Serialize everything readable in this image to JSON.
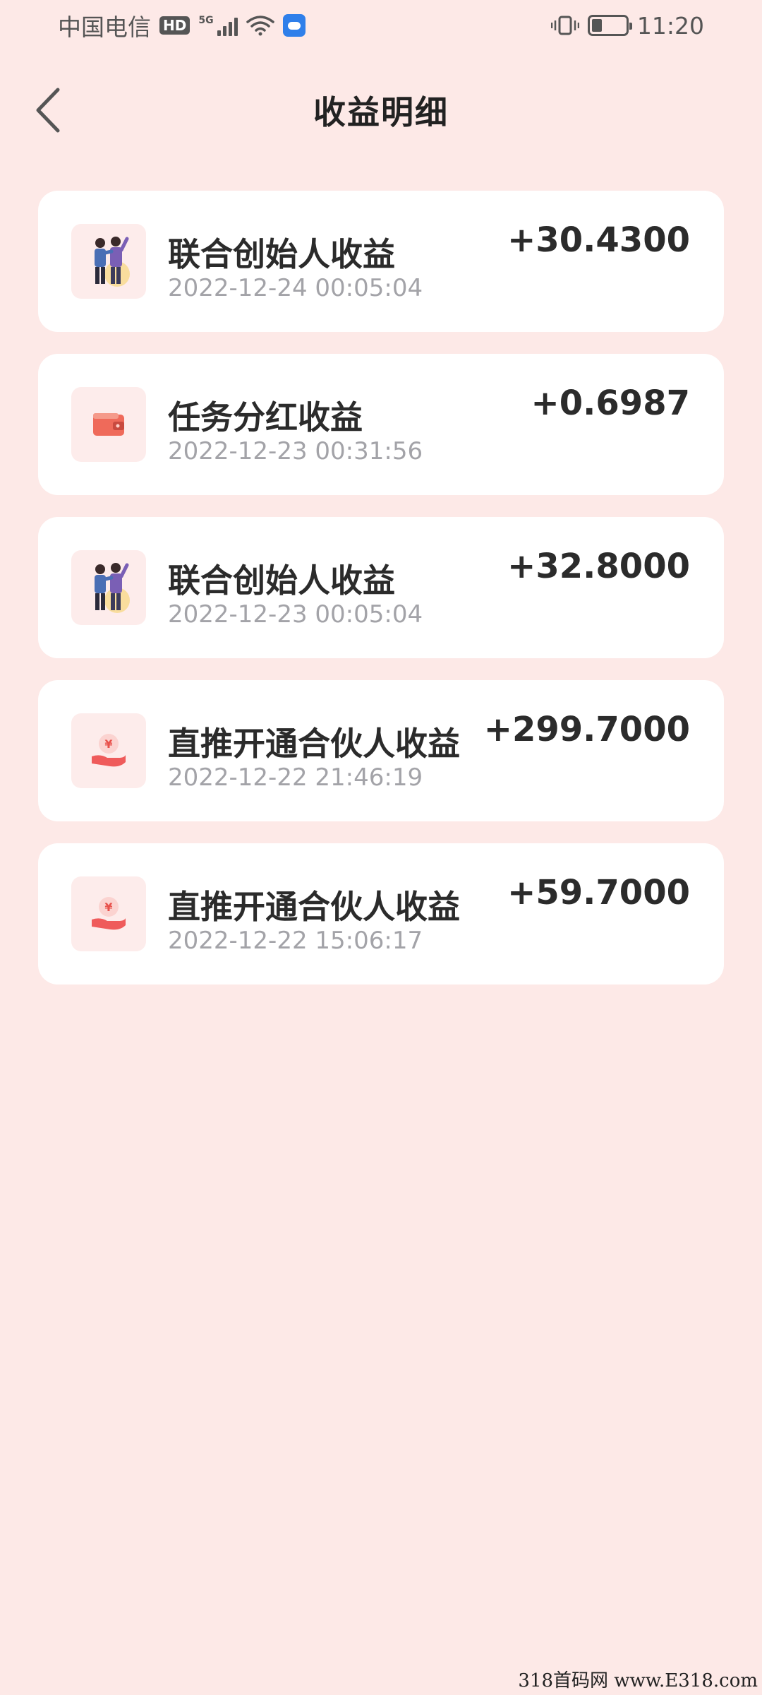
{
  "status_bar": {
    "carrier": "中国电信",
    "hd": "HD",
    "network": "5G",
    "time": "11:20",
    "battery_level": 0.3
  },
  "header": {
    "title": "收益明细"
  },
  "colors": {
    "background": "#fde9e7",
    "card": "#ffffff",
    "icon_bg": "#fdeceb",
    "accent": "#ef5b5b"
  },
  "records": [
    {
      "icon": "cofounder-icon",
      "title": "联合创始人收益",
      "time": "2022-12-24 00:05:04",
      "amount": "+30.4300"
    },
    {
      "icon": "wallet-icon",
      "title": "任务分红收益",
      "time": "2022-12-23 00:31:56",
      "amount": "+0.6987"
    },
    {
      "icon": "cofounder-icon",
      "title": "联合创始人收益",
      "time": "2022-12-23 00:05:04",
      "amount": "+32.8000"
    },
    {
      "icon": "yuan-hand-icon",
      "title": "直推开通合伙人收益",
      "time": "2022-12-22 21:46:19",
      "amount": "+299.7000"
    },
    {
      "icon": "yuan-hand-icon",
      "title": "直推开通合伙人收益",
      "time": "2022-12-22 15:06:17",
      "amount": "+59.7000"
    }
  ],
  "watermark": "318首码网 www.E318.com"
}
